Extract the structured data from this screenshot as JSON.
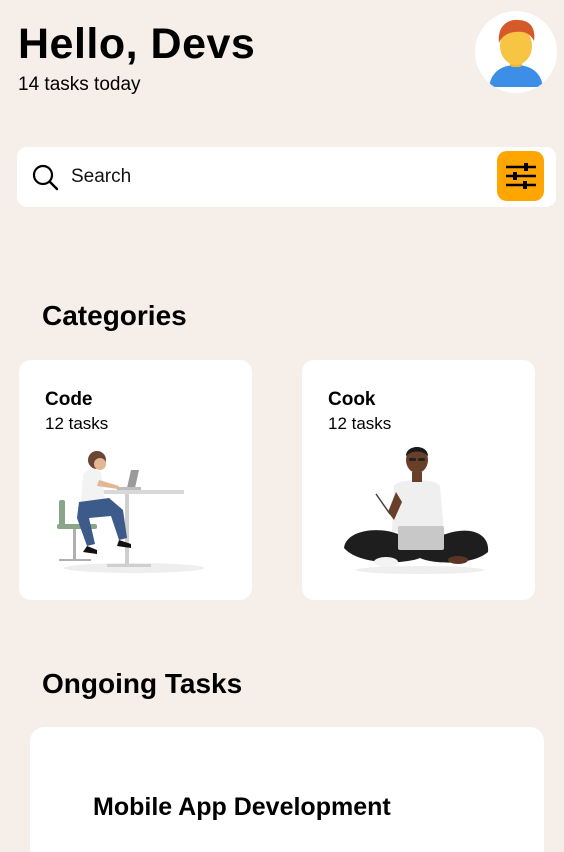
{
  "header": {
    "greeting": "Hello, Devs",
    "subtitle": "14 tasks today",
    "avatar_icon": "user-avatar-icon"
  },
  "search": {
    "placeholder": "Search",
    "search_icon": "search-icon",
    "filter_icon": "sliders-icon"
  },
  "categories": {
    "title": "Categories",
    "items": [
      {
        "name": "Code",
        "count": "12 tasks",
        "illustration": "person-at-desk-laptop"
      },
      {
        "name": "Cook",
        "count": "12 tasks",
        "illustration": "person-sitting-with-laptop"
      }
    ]
  },
  "ongoing": {
    "title": "Ongoing Tasks",
    "tasks": [
      {
        "title": "Mobile App Development"
      }
    ]
  },
  "colors": {
    "background": "#f6eee8",
    "accent": "#ffa500",
    "card": "#ffffff"
  }
}
